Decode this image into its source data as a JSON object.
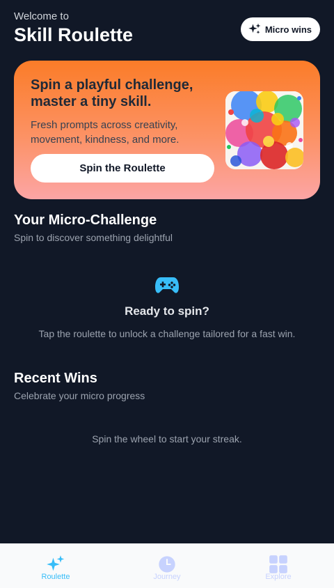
{
  "header": {
    "welcome": "Welcome to",
    "title": "Skill Roulette",
    "badge_label": "Micro wins",
    "badge_icon": "sparkles-icon"
  },
  "hero": {
    "title": "Spin a playful challenge, master a tiny skill.",
    "description": "Fresh prompts across creativity, movement, kindness, and more.",
    "button_label": "Spin the Roulette",
    "image": "paint-splash-image"
  },
  "challenge": {
    "title": "Your Micro-Challenge",
    "subtitle": "Spin to discover something delightful",
    "empty_icon": "gamepad-icon",
    "empty_title": "Ready to spin?",
    "empty_text": "Tap the roulette to unlock a challenge tailored for a fast win."
  },
  "wins": {
    "title": "Recent Wins",
    "subtitle": "Celebrate your micro progress",
    "empty_text": "Spin the wheel to start your streak."
  },
  "tabs": [
    {
      "label": "Roulette",
      "icon": "sparkles-icon",
      "active": true
    },
    {
      "label": "Journey",
      "icon": "clock-icon",
      "active": false
    },
    {
      "label": "Explore",
      "icon": "grid-icon",
      "active": false
    }
  ],
  "colors": {
    "background": "#111827",
    "accent": "#38bdf8",
    "hero_top": "#fb7c28",
    "hero_bottom": "#fca5a5"
  }
}
